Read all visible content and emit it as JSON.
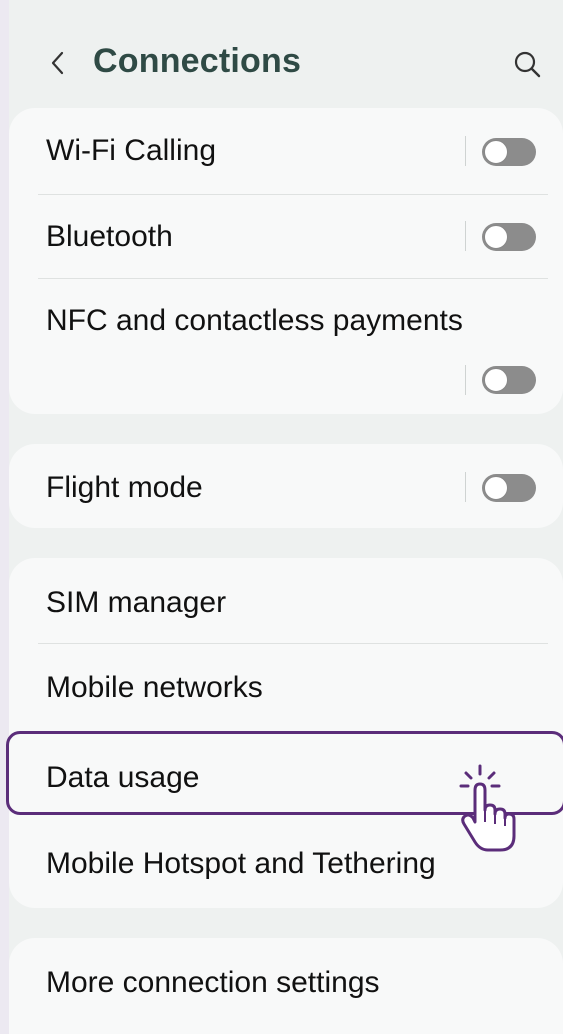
{
  "header": {
    "title": "Connections",
    "back_icon": "chevron-left-icon",
    "search_icon": "search-icon"
  },
  "group1": [
    {
      "label": "Wi-Fi Calling",
      "toggle": "off"
    },
    {
      "label": "Bluetooth",
      "toggle": "off"
    },
    {
      "label": "NFC and contactless payments",
      "toggle": "off"
    }
  ],
  "group2": [
    {
      "label": "Flight mode",
      "toggle": "off"
    }
  ],
  "group3": [
    {
      "label": "SIM manager"
    },
    {
      "label": "Mobile networks"
    },
    {
      "label": "Data usage"
    },
    {
      "label": "Mobile Hotspot and Tethering"
    }
  ],
  "group4": [
    {
      "label": "More connection settings"
    }
  ],
  "colors": {
    "title": "#2f4a45",
    "highlight": "#5b2d7a",
    "toggle_off": "#8c8c8c"
  }
}
